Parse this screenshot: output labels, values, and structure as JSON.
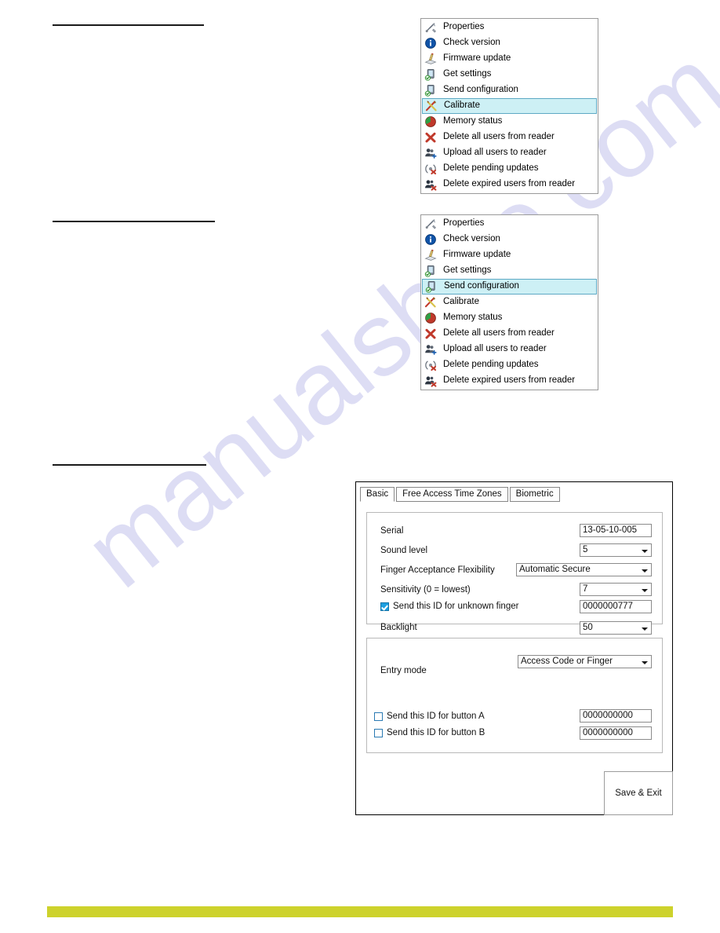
{
  "page": {
    "watermark_text": "manualshive.com",
    "accent_color": "#cdd22c",
    "redaction_rules": [
      {
        "name": "rule-1"
      },
      {
        "name": "rule-2"
      },
      {
        "name": "rule-3"
      }
    ]
  },
  "context_menu_one": {
    "selected": "Calibrate",
    "highlight_fill": "#cdf0f5",
    "highlight_border": "#5ea9c4",
    "items": [
      {
        "label": "Properties",
        "icon": "wrench-screwdriver-icon",
        "selected": false
      },
      {
        "label": "Check version",
        "icon": "info-globe-icon",
        "selected": false
      },
      {
        "label": "Firmware update",
        "icon": "firmware-update-icon",
        "selected": false
      },
      {
        "label": "Get settings",
        "icon": "device-download-icon",
        "selected": false
      },
      {
        "label": "Send configuration",
        "icon": "device-upload-icon",
        "selected": false
      },
      {
        "label": "Calibrate",
        "icon": "calibrate-tools-icon",
        "selected": true
      },
      {
        "label": "Memory status",
        "icon": "pie-chart-icon",
        "selected": false
      },
      {
        "label": "Delete all users from reader",
        "icon": "red-x-icon",
        "selected": false
      },
      {
        "label": "Upload all users to reader",
        "icon": "users-plus-icon",
        "selected": false
      },
      {
        "label": "Delete pending updates",
        "icon": "signal-delete-icon",
        "selected": false
      },
      {
        "label": "Delete expired users from reader",
        "icon": "users-delete-icon",
        "selected": false
      }
    ]
  },
  "context_menu_two": {
    "selected": "Send configuration",
    "highlight_fill": "#cdf0f5",
    "highlight_border": "#5ea9c4",
    "items": [
      {
        "label": "Properties",
        "icon": "wrench-screwdriver-icon",
        "selected": false
      },
      {
        "label": "Check version",
        "icon": "info-globe-icon",
        "selected": false
      },
      {
        "label": "Firmware update",
        "icon": "firmware-update-icon",
        "selected": false
      },
      {
        "label": "Get settings",
        "icon": "device-download-icon",
        "selected": false
      },
      {
        "label": "Send configuration",
        "icon": "device-upload-icon",
        "selected": true
      },
      {
        "label": "Calibrate",
        "icon": "calibrate-tools-icon",
        "selected": false
      },
      {
        "label": "Memory status",
        "icon": "pie-chart-icon",
        "selected": false
      },
      {
        "label": "Delete all users from reader",
        "icon": "red-x-icon",
        "selected": false
      },
      {
        "label": "Upload all users to reader",
        "icon": "users-plus-icon",
        "selected": false
      },
      {
        "label": "Delete pending updates",
        "icon": "signal-delete-icon",
        "selected": false
      },
      {
        "label": "Delete expired users from reader",
        "icon": "users-delete-icon",
        "selected": false
      }
    ]
  },
  "config_dialog": {
    "tabs": [
      {
        "label": "Basic",
        "active": true
      },
      {
        "label": "Free Access Time Zones",
        "active": false
      },
      {
        "label": "Biometric",
        "active": false
      }
    ],
    "basic_group": {
      "serial": {
        "label": "Serial",
        "value": "13-05-10-005"
      },
      "sound_level": {
        "label": "Sound level",
        "value": "5"
      },
      "finger_acceptance": {
        "label": "Finger Acceptance Flexibility",
        "value": "Automatic Secure"
      },
      "sensitivity": {
        "label": "Sensitivity (0 = lowest)",
        "value": "7"
      },
      "unknown_finger": {
        "label": "Send this ID for unknown finger",
        "value": "0000000777",
        "checked": true
      },
      "backlight": {
        "label": "Backlight",
        "value": "50"
      }
    },
    "entry_group": {
      "entry_mode": {
        "label": "Entry mode",
        "value": "Access Code or Finger"
      },
      "button_a": {
        "label": "Send this ID for button A",
        "value": "0000000000",
        "checked": false
      },
      "button_b": {
        "label": "Send this ID for button B",
        "value": "0000000000",
        "checked": false
      }
    },
    "save_button": {
      "label": "Save & Exit"
    }
  }
}
